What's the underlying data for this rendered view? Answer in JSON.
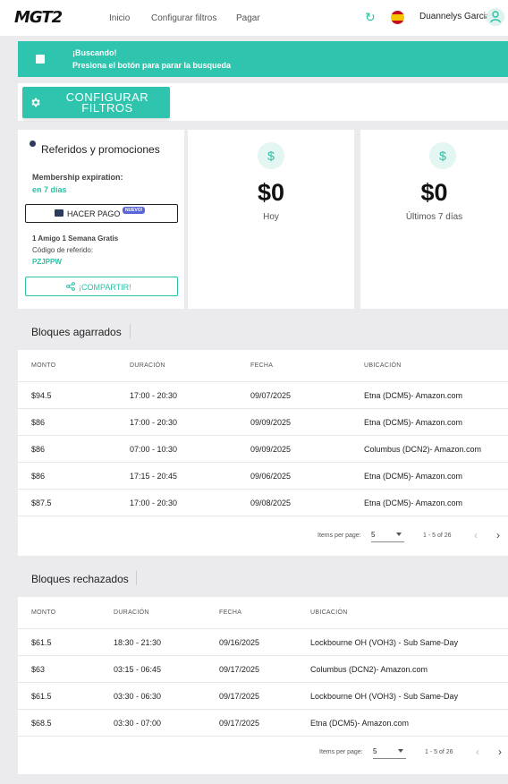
{
  "header": {
    "logo": "MGT2",
    "nav": [
      "Inicio",
      "Configurar filtros",
      "Pagar"
    ],
    "username": "Duannelys Garcia"
  },
  "banner": {
    "title": "¡Buscando!",
    "message": "Presiona el botón para parar la busqueda"
  },
  "config_button": {
    "line1": "CONFIGURAR",
    "line2": "FILTROS"
  },
  "referral": {
    "title": "Referidos y promociones",
    "membership_label": "Membership expiration:",
    "membership_value": "en 7 días",
    "pay_label": "HACER PAGO",
    "pay_badge": "NUEVO!",
    "promo": "1 Amigo 1 Semana Gratis",
    "code_label": "Código de referido:",
    "code": "PZJPPW",
    "share_label": "¡COMPARTIR!"
  },
  "stats": [
    {
      "amount": "$0",
      "label": "Hoy"
    },
    {
      "amount": "$0",
      "label": "Últimos 7 días"
    }
  ],
  "grabbed": {
    "title": "Bloques agarrados",
    "columns": [
      "MONTO",
      "DURACIÓN",
      "FECHA",
      "UBICACIÓN"
    ],
    "rows": [
      [
        "$94.5",
        "17:00 - 20:30",
        "09/07/2025",
        "Etna (DCM5)- Amazon.com"
      ],
      [
        "$86",
        "17:00 - 20:30",
        "09/09/2025",
        "Etna (DCM5)- Amazon.com"
      ],
      [
        "$86",
        "07:00 - 10:30",
        "09/09/2025",
        "Columbus (DCN2)- Amazon.com"
      ],
      [
        "$86",
        "17:15 - 20:45",
        "09/06/2025",
        "Etna (DCM5)- Amazon.com"
      ],
      [
        "$87.5",
        "17:00 - 20:30",
        "09/08/2025",
        "Etna (DCM5)- Amazon.com"
      ]
    ],
    "items_per_page_label": "Items per page:",
    "items_per_page": "5",
    "range": "1 - 5 of 26"
  },
  "rejected": {
    "title": "Bloques rechazados",
    "columns": [
      "MONTO",
      "DURACIÓN",
      "FECHA",
      "UBICACIÓN"
    ],
    "rows": [
      [
        "$61.5",
        "18:30 - 21:30",
        "09/16/2025",
        "Lockbourne OH (VOH3) - Sub Same-Day"
      ],
      [
        "$63",
        "03:15 - 06:45",
        "09/17/2025",
        "Columbus (DCN2)- Amazon.com"
      ],
      [
        "$61.5",
        "03:30 - 06:30",
        "09/17/2025",
        "Lockbourne OH (VOH3) - Sub Same-Day"
      ],
      [
        "$68.5",
        "03:30 - 07:00",
        "09/17/2025",
        "Etna (DCM5)- Amazon.com"
      ]
    ],
    "items_per_page_label": "Items per page:",
    "items_per_page": "5",
    "range": "1 - 5 of 26"
  }
}
